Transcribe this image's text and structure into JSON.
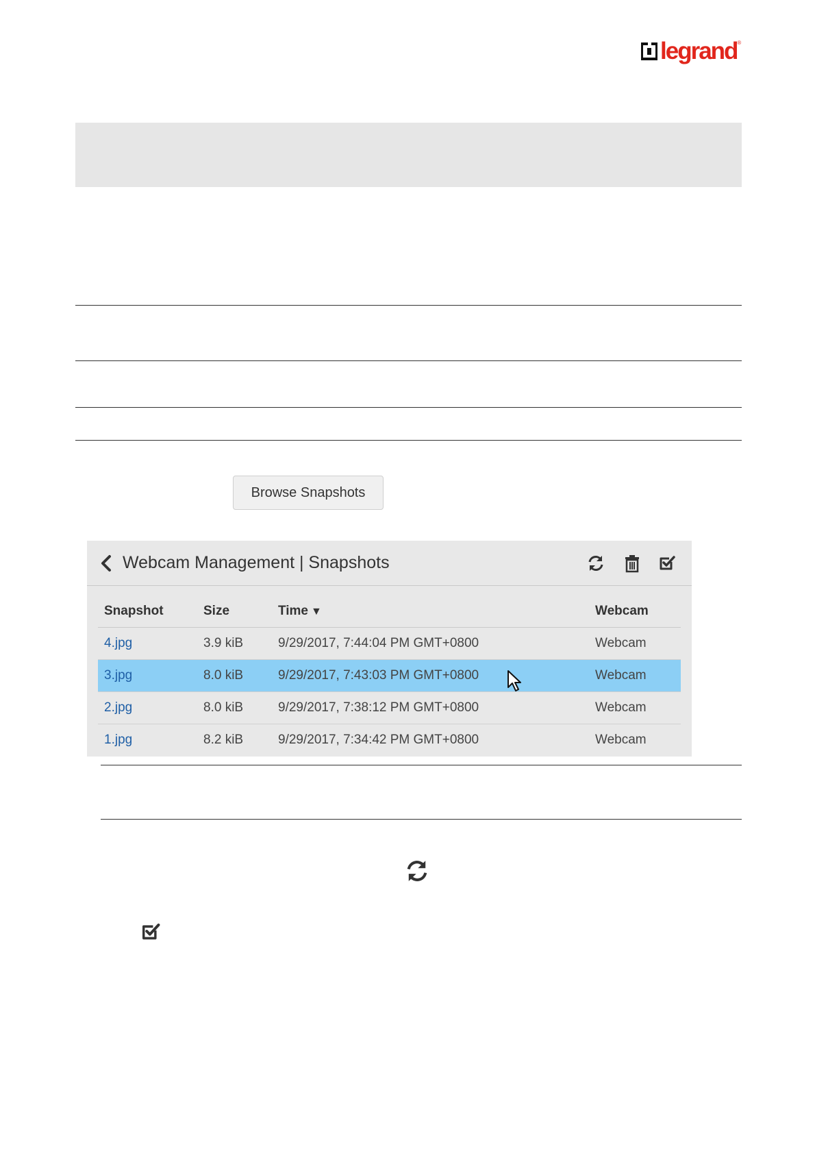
{
  "header": {
    "logo_text": "legrand",
    "logo_mark": "®"
  },
  "browse_button": {
    "label": "Browse Snapshots"
  },
  "panel": {
    "title": "Webcam Management | Snapshots",
    "icons": [
      "back-icon",
      "refresh-icon",
      "trash-icon",
      "check-square-icon"
    ]
  },
  "table": {
    "columns": [
      "Snapshot",
      "Size",
      "Time",
      "Webcam"
    ],
    "sort_indicator": "▼",
    "rows": [
      {
        "snapshot": "4.jpg",
        "size": "3.9 kiB",
        "time": "9/29/2017, 7:44:04 PM GMT+0800",
        "webcam": "Webcam",
        "selected": false
      },
      {
        "snapshot": "3.jpg",
        "size": "8.0 kiB",
        "time": "9/29/2017, 7:43:03 PM GMT+0800",
        "webcam": "Webcam",
        "selected": true
      },
      {
        "snapshot": "2.jpg",
        "size": "8.0 kiB",
        "time": "9/29/2017, 7:38:12 PM GMT+0800",
        "webcam": "Webcam",
        "selected": false
      },
      {
        "snapshot": "1.jpg",
        "size": "8.2 kiB",
        "time": "9/29/2017, 7:34:42 PM GMT+0800",
        "webcam": "Webcam",
        "selected": false
      }
    ]
  },
  "colors": {
    "selected_row": "#8ccff5",
    "link": "#1f5fa6",
    "brand": "#e1261c",
    "panel_bg": "#e8e8e8"
  }
}
